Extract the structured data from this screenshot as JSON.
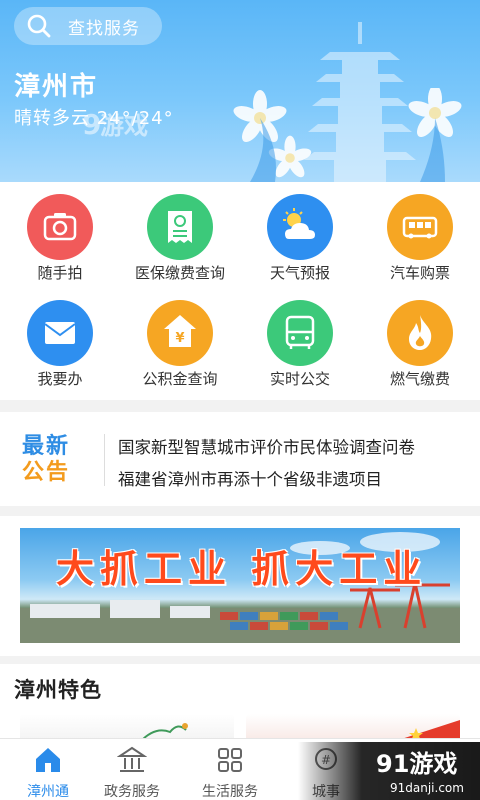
{
  "search": {
    "label": "查找服务",
    "icon": "search-icon"
  },
  "header": {
    "city": "漳州市",
    "weather": "晴转多云 24°/24°"
  },
  "services": [
    {
      "label": "随手拍",
      "icon": "camera-icon",
      "color": "#f15a5a"
    },
    {
      "label": "医保缴费查询",
      "icon": "receipt-icon",
      "color": "#3cc97a"
    },
    {
      "label": "天气预报",
      "icon": "weather-icon",
      "color": "#2e8ff0"
    },
    {
      "label": "汽车购票",
      "icon": "bus-ticket-icon",
      "color": "#f6a623"
    },
    {
      "label": "我要办",
      "icon": "envelope-icon",
      "color": "#2e8ff0"
    },
    {
      "label": "公积金查询",
      "icon": "fund-icon",
      "color": "#f6a623"
    },
    {
      "label": "实时公交",
      "icon": "bus-icon",
      "color": "#3cc97a"
    },
    {
      "label": "燃气缴费",
      "icon": "flame-icon",
      "color": "#f6a623"
    }
  ],
  "notice": {
    "logo_line1": "最新",
    "logo_line2": "公告",
    "items": [
      "国家新型智慧城市评价市民体验调查问卷",
      "福建省漳州市再添十个省级非遗项目"
    ]
  },
  "banner": {
    "title": "大抓工业  抓大工业"
  },
  "features": {
    "title": "漳州特色"
  },
  "nav": [
    {
      "label": "漳州通",
      "icon": "home-icon",
      "active": true
    },
    {
      "label": "政务服务",
      "icon": "government-icon",
      "active": false
    },
    {
      "label": "生活服务",
      "icon": "grid-icon",
      "active": false
    },
    {
      "label": "城事",
      "icon": "city-icon",
      "active": false
    }
  ],
  "watermark": {
    "text": "91游戏",
    "url": "91danji.com"
  }
}
